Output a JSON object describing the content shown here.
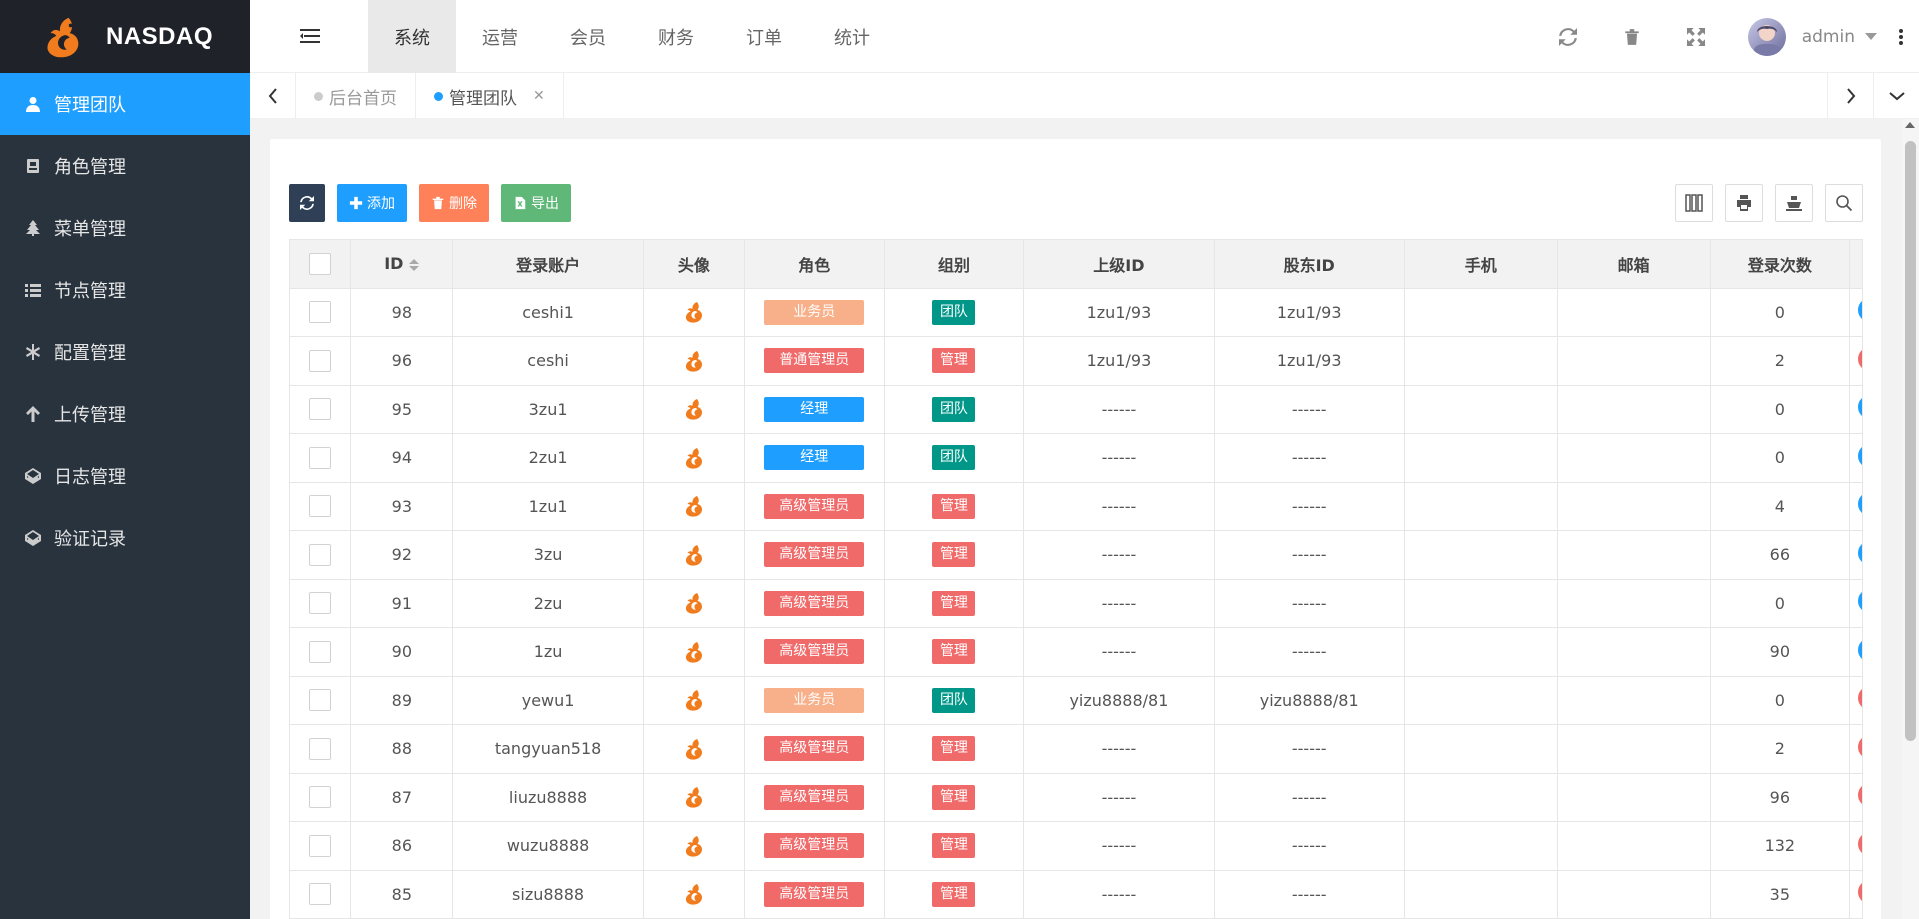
{
  "app": {
    "brand": "NASDAQ"
  },
  "sidebar": {
    "items": [
      {
        "label": "管理团队",
        "icon": "user-icon",
        "active": true
      },
      {
        "label": "角色管理",
        "icon": "id-card-icon",
        "active": false
      },
      {
        "label": "菜单管理",
        "icon": "tree-icon",
        "active": false
      },
      {
        "label": "节点管理",
        "icon": "list-icon",
        "active": false
      },
      {
        "label": "配置管理",
        "icon": "asterisk-icon",
        "active": false
      },
      {
        "label": "上传管理",
        "icon": "arrow-up-icon",
        "active": false
      },
      {
        "label": "日志管理",
        "icon": "codepen-icon",
        "active": false
      },
      {
        "label": "验证记录",
        "icon": "codepen-icon",
        "active": false
      }
    ]
  },
  "header": {
    "tabs": [
      {
        "label": "系统",
        "active": true
      },
      {
        "label": "运营",
        "active": false
      },
      {
        "label": "会员",
        "active": false
      },
      {
        "label": "财务",
        "active": false
      },
      {
        "label": "订单",
        "active": false
      },
      {
        "label": "统计",
        "active": false
      }
    ],
    "username": "admin"
  },
  "page_tabs": [
    {
      "label": "后台首页",
      "active": false,
      "closable": false
    },
    {
      "label": "管理团队",
      "active": true,
      "closable": true
    }
  ],
  "toolbar": {
    "add_label": "添加",
    "delete_label": "删除",
    "export_label": "导出"
  },
  "table": {
    "columns": [
      "ID",
      "登录账户",
      "头像",
      "角色",
      "组别",
      "上级ID",
      "股东ID",
      "手机",
      "邮箱",
      "登录次数"
    ],
    "rows": [
      {
        "id": "98",
        "account": "ceshi1",
        "role": "业务员",
        "group": "团队",
        "parent": "1zu1/93",
        "holder": "1zu1/93",
        "phone": "",
        "email": "",
        "logins": "0",
        "status": "blue"
      },
      {
        "id": "96",
        "account": "ceshi",
        "role": "普通管理员",
        "group": "管理",
        "parent": "1zu1/93",
        "holder": "1zu1/93",
        "phone": "",
        "email": "",
        "logins": "2",
        "status": "red"
      },
      {
        "id": "95",
        "account": "3zu1",
        "role": "经理",
        "group": "团队",
        "parent": "------",
        "holder": "------",
        "phone": "",
        "email": "",
        "logins": "0",
        "status": "blue"
      },
      {
        "id": "94",
        "account": "2zu1",
        "role": "经理",
        "group": "团队",
        "parent": "------",
        "holder": "------",
        "phone": "",
        "email": "",
        "logins": "0",
        "status": "blue"
      },
      {
        "id": "93",
        "account": "1zu1",
        "role": "高级管理员",
        "group": "管理",
        "parent": "------",
        "holder": "------",
        "phone": "",
        "email": "",
        "logins": "4",
        "status": "blue"
      },
      {
        "id": "92",
        "account": "3zu",
        "role": "高级管理员",
        "group": "管理",
        "parent": "------",
        "holder": "------",
        "phone": "",
        "email": "",
        "logins": "66",
        "status": "blue"
      },
      {
        "id": "91",
        "account": "2zu",
        "role": "高级管理员",
        "group": "管理",
        "parent": "------",
        "holder": "------",
        "phone": "",
        "email": "",
        "logins": "0",
        "status": "blue"
      },
      {
        "id": "90",
        "account": "1zu",
        "role": "高级管理员",
        "group": "管理",
        "parent": "------",
        "holder": "------",
        "phone": "",
        "email": "",
        "logins": "90",
        "status": "blue"
      },
      {
        "id": "89",
        "account": "yewu1",
        "role": "业务员",
        "group": "团队",
        "parent": "yizu8888/81",
        "holder": "yizu8888/81",
        "phone": "",
        "email": "",
        "logins": "0",
        "status": "red"
      },
      {
        "id": "88",
        "account": "tangyuan518",
        "role": "高级管理员",
        "group": "管理",
        "parent": "------",
        "holder": "------",
        "phone": "",
        "email": "",
        "logins": "2",
        "status": "red"
      },
      {
        "id": "87",
        "account": "liuzu8888",
        "role": "高级管理员",
        "group": "管理",
        "parent": "------",
        "holder": "------",
        "phone": "",
        "email": "",
        "logins": "96",
        "status": "red"
      },
      {
        "id": "86",
        "account": "wuzu8888",
        "role": "高级管理员",
        "group": "管理",
        "parent": "------",
        "holder": "------",
        "phone": "",
        "email": "",
        "logins": "132",
        "status": "red"
      },
      {
        "id": "85",
        "account": "sizu8888",
        "role": "高级管理员",
        "group": "管理",
        "parent": "------",
        "holder": "------",
        "phone": "",
        "email": "",
        "logins": "35",
        "status": "red"
      }
    ]
  },
  "colors": {
    "sidebar_bg": "#28333e",
    "accent": "#1e9fff",
    "role_sales": "#f8b08a",
    "role_admin": "#f06a6a",
    "role_manager": "#1e9fff",
    "group_team": "#009688",
    "group_manage": "#f06a6a",
    "status_blue": "#1e9fff",
    "status_red": "#f06a6a"
  }
}
